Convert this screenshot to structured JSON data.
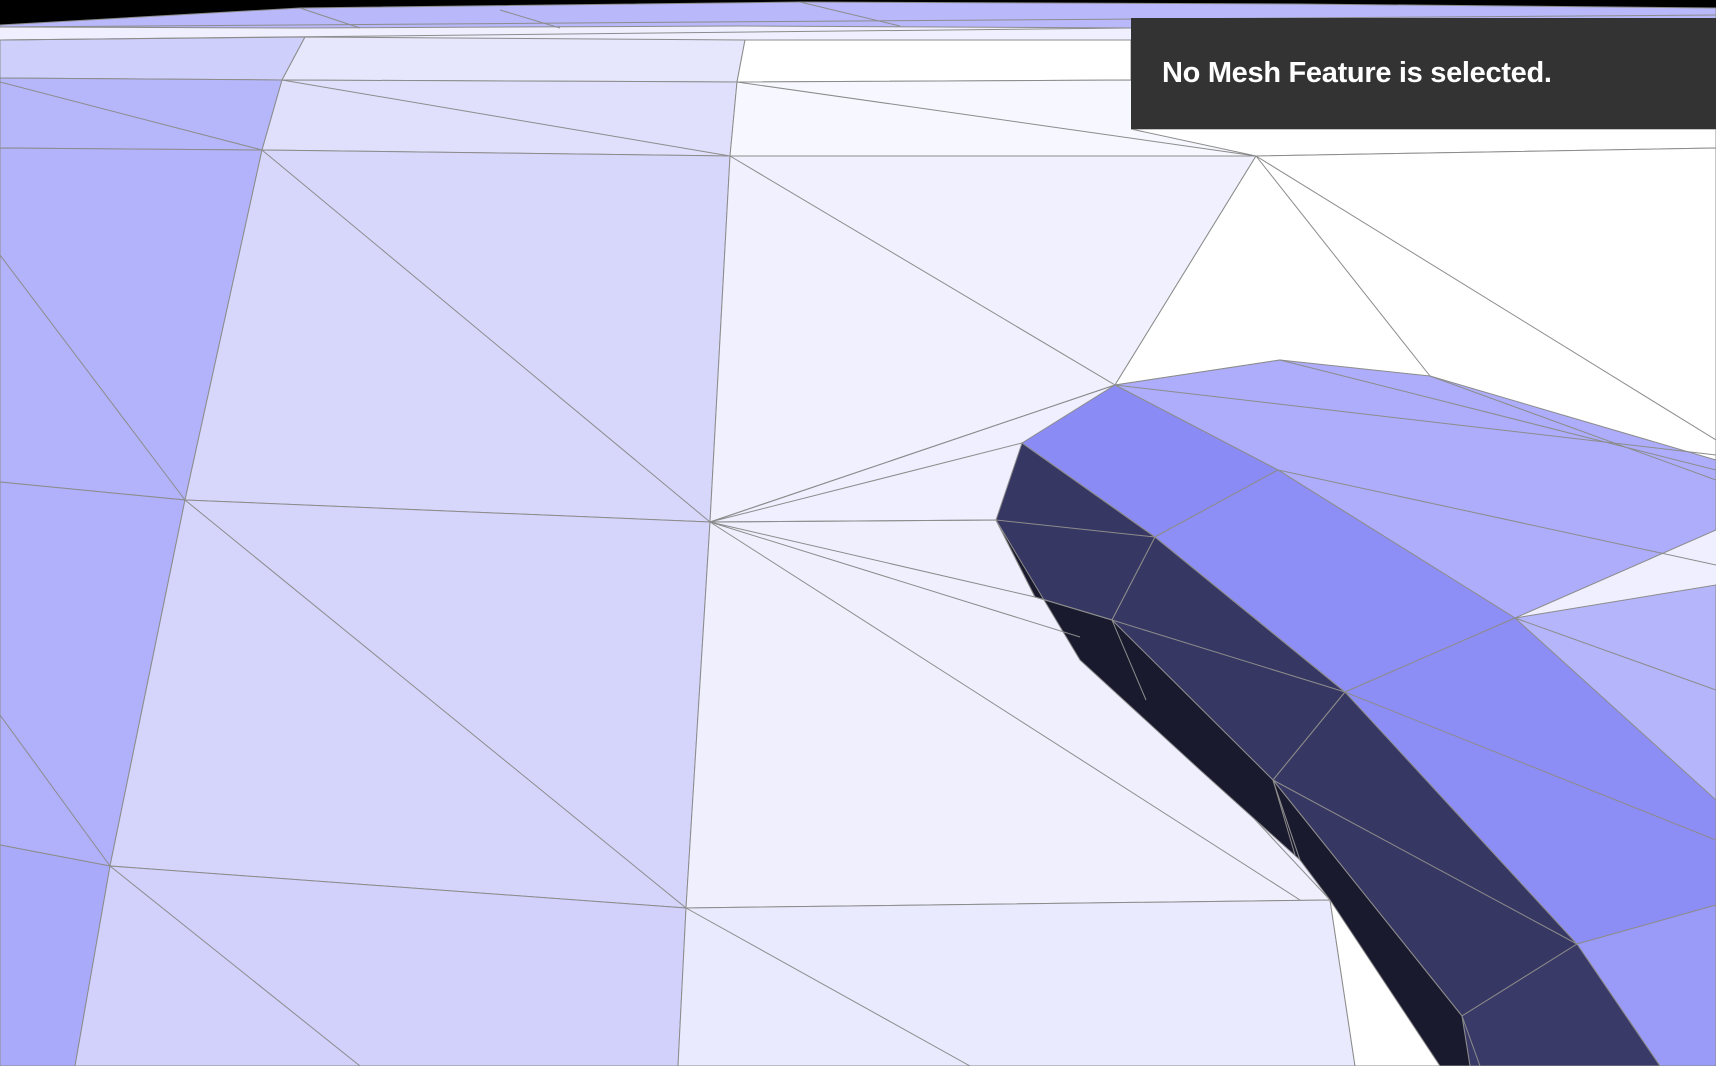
{
  "status_banner": {
    "message": "No Mesh Feature is selected."
  },
  "viewport": {
    "content": "3d-mesh-wireframe",
    "colors": {
      "background": "#000000",
      "mesh_edge": "#8c8c8c",
      "face_lightest": "#ffffff",
      "face_light": "#ebebff",
      "face_mid": "#d4d4fb",
      "face_strong": "#adadfb",
      "face_accent": "#8b8bf5",
      "face_dark": "#373763",
      "face_darkest": "#1a1a2e",
      "banner_background": "#333333",
      "banner_text": "#ffffff"
    }
  }
}
